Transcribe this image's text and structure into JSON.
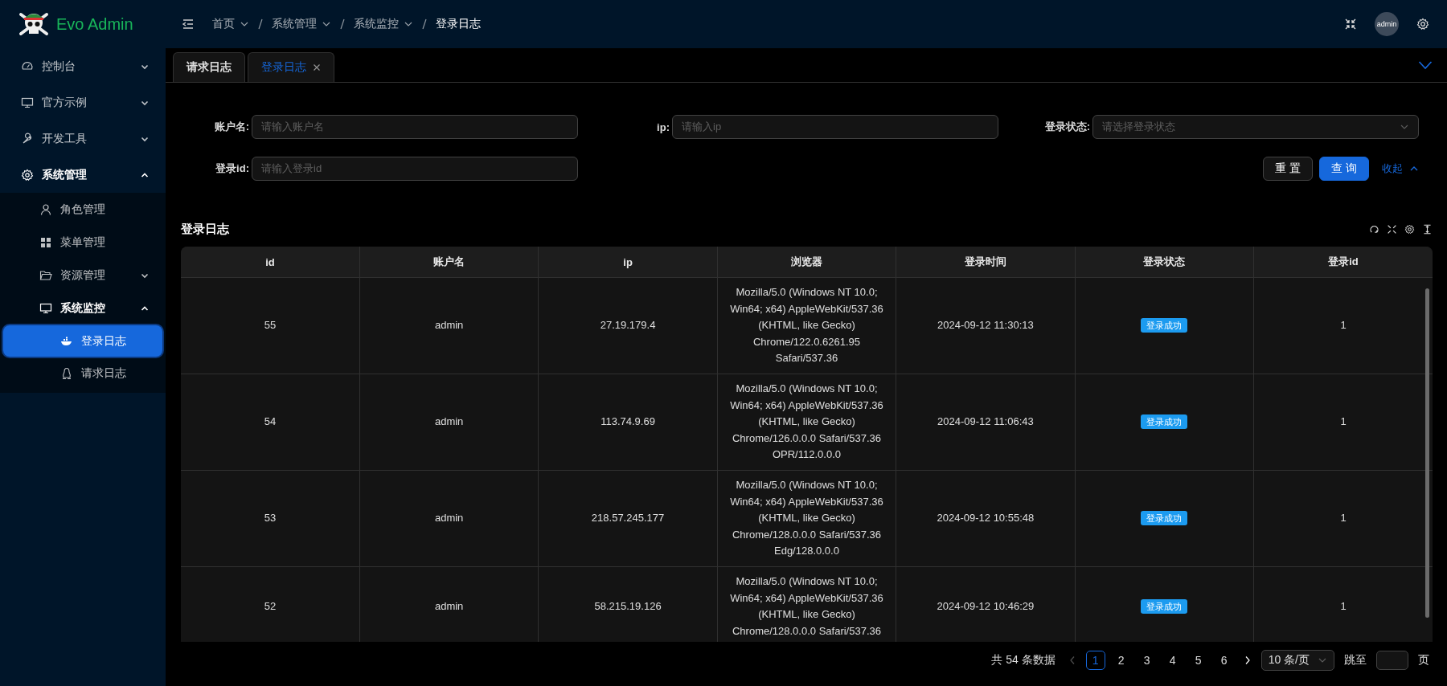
{
  "brand": {
    "name": "Evo Admin"
  },
  "breadcrumb": [
    {
      "label": "首页",
      "has_menu": true
    },
    {
      "label": "系统管理",
      "has_menu": true
    },
    {
      "label": "系统监控",
      "has_menu": true
    },
    {
      "label": "登录日志",
      "has_menu": false
    }
  ],
  "header": {
    "avatar": "admin"
  },
  "sidebar": {
    "items": [
      {
        "label": "控制台",
        "expanded": false
      },
      {
        "label": "官方示例",
        "expanded": false
      },
      {
        "label": "开发工具",
        "expanded": false
      },
      {
        "label": "系统管理",
        "expanded": true,
        "children": [
          {
            "label": "角色管理"
          },
          {
            "label": "菜单管理"
          },
          {
            "label": "资源管理",
            "expanded": false
          },
          {
            "label": "系统监控",
            "expanded": true,
            "children": [
              {
                "label": "登录日志",
                "selected": true
              },
              {
                "label": "请求日志",
                "selected": false
              }
            ]
          }
        ]
      }
    ]
  },
  "tabs": [
    {
      "label": "请求日志",
      "selected": false,
      "closable": false
    },
    {
      "label": "登录日志",
      "selected": true,
      "closable": true
    }
  ],
  "filters": [
    {
      "label": "账户名:",
      "placeholder": "请输入账户名",
      "kind": "input"
    },
    {
      "label": "ip:",
      "placeholder": "请输入ip",
      "kind": "input"
    },
    {
      "label": "登录状态:",
      "placeholder": "请选择登录状态",
      "kind": "select"
    },
    {
      "label": "登录id:",
      "placeholder": "请输入登录id",
      "kind": "input"
    }
  ],
  "filter_buttons": {
    "reset": "重 置",
    "search": "查 询",
    "collapse": "收起"
  },
  "table": {
    "title": "登录日志",
    "columns": [
      "id",
      "账户名",
      "ip",
      "浏览器",
      "登录时间",
      "登录状态",
      "登录id"
    ],
    "rows": [
      {
        "id": "55",
        "account": "admin",
        "ip": "27.19.179.4",
        "browser": "Mozilla/5.0 (Windows NT 10.0;\nWin64; x64) AppleWebKit/537.36\n(KHTML, like Gecko)\nChrome/122.0.6261.95\nSafari/537.36",
        "time": "2024-09-12 11:30:13",
        "status": "登录成功",
        "login_id": "1"
      },
      {
        "id": "54",
        "account": "admin",
        "ip": "113.74.9.69",
        "browser": "Mozilla/5.0 (Windows NT 10.0;\nWin64; x64) AppleWebKit/537.36\n(KHTML, like Gecko)\nChrome/126.0.0.0 Safari/537.36\nOPR/112.0.0.0",
        "time": "2024-09-12 11:06:43",
        "status": "登录成功",
        "login_id": "1"
      },
      {
        "id": "53",
        "account": "admin",
        "ip": "218.57.245.177",
        "browser": "Mozilla/5.0 (Windows NT 10.0;\nWin64; x64) AppleWebKit/537.36\n(KHTML, like Gecko)\nChrome/128.0.0.0 Safari/537.36\nEdg/128.0.0.0",
        "time": "2024-09-12 10:55:48",
        "status": "登录成功",
        "login_id": "1"
      },
      {
        "id": "52",
        "account": "admin",
        "ip": "58.215.19.126",
        "browser": "Mozilla/5.0 (Windows NT 10.0;\nWin64; x64) AppleWebKit/537.36\n(KHTML, like Gecko)\nChrome/128.0.0.0 Safari/537.36",
        "time": "2024-09-12 10:46:29",
        "status": "登录成功",
        "login_id": "1"
      }
    ]
  },
  "pagination": {
    "total": "共 54 条数据",
    "pages": [
      {
        "label": "1",
        "selected": true
      },
      {
        "label": "2",
        "selected": false
      },
      {
        "label": "3",
        "selected": false
      },
      {
        "label": "4",
        "selected": false
      },
      {
        "label": "5",
        "selected": false
      },
      {
        "label": "6",
        "selected": false
      }
    ],
    "page_size": "10 条/页",
    "jump_label": "跳至",
    "jump_suffix": "页"
  }
}
